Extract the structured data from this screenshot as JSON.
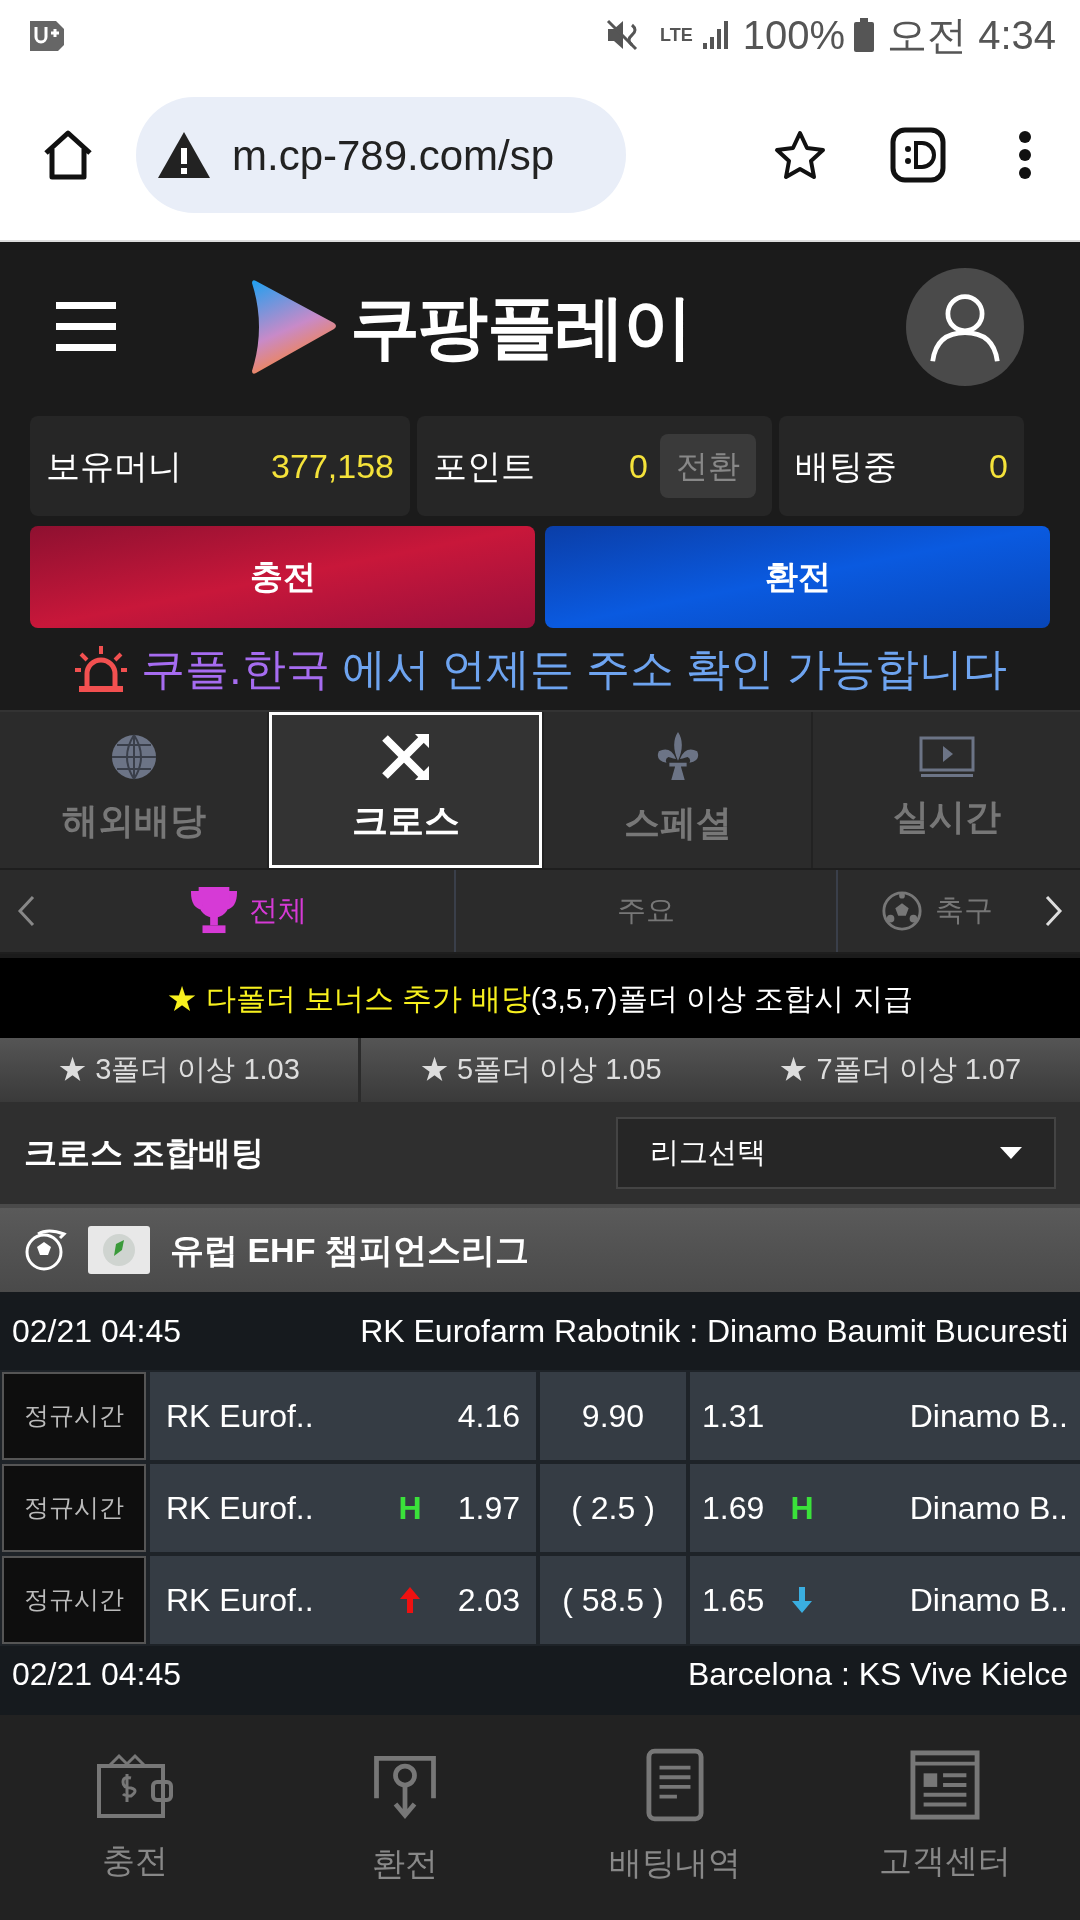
{
  "status_bar": {
    "lte": "LTE",
    "battery": "100%",
    "time": "오전 4:34"
  },
  "browser": {
    "url": "m.cp-789.com/sp"
  },
  "header": {
    "logo_text": "쿠팡플레이"
  },
  "balances": [
    {
      "label": "보유머니",
      "value": "377,158"
    },
    {
      "label": "포인트",
      "value": "0",
      "action": "전환"
    },
    {
      "label": "배팅중",
      "value": "0"
    }
  ],
  "actions": [
    {
      "label": "충전",
      "kind": "deposit"
    },
    {
      "label": "환전",
      "kind": "withdraw"
    }
  ],
  "notice": {
    "link": "쿠플.한국",
    "text": "에서 언제든 주소 확인 가능합니다"
  },
  "tabs": [
    {
      "label": "해외배당",
      "kind": "globe",
      "selected": false
    },
    {
      "label": "크로스",
      "kind": "cross",
      "selected": true
    },
    {
      "label": "스페셜",
      "kind": "fleur",
      "selected": false
    },
    {
      "label": "실시간",
      "kind": "live",
      "selected": false
    }
  ],
  "categories": [
    {
      "label": "전체",
      "kind": "trophy",
      "selected": true
    },
    {
      "label": "주요",
      "kind": "none",
      "selected": false
    },
    {
      "label": "축구",
      "kind": "ball",
      "selected": false
    }
  ],
  "bonus": {
    "highlight": "★ 다폴더 보너스 추가 배당",
    "text": "(3,5,7)폴더 이상 조합시 지급",
    "tiers": [
      "★ 3폴더 이상 1.03",
      "★ 5폴더 이상 1.05",
      "★ 7폴더 이상 1.07"
    ]
  },
  "section": {
    "title": "크로스 조합배팅",
    "select": "리그선택"
  },
  "league": {
    "name": "유럽 EHF 챔피언스리그"
  },
  "matches": [
    {
      "time": "02/21 04:45",
      "teams": "RK Eurofarm Rabotnik : Dinamo Baumit Bucuresti",
      "rows": [
        {
          "period": "정규시간",
          "home": "RK Eurof..",
          "home_odds": "4.16",
          "middle": "9.90",
          "away_odds": "1.31",
          "away": "Dinamo B.."
        },
        {
          "period": "정규시간",
          "home": "RK Eurof..",
          "home_mark": {
            "kind": "flag",
            "text": "H"
          },
          "home_odds": "1.97",
          "middle": "( 2.5 )",
          "away_odds": "1.69",
          "away_mark": {
            "kind": "flag",
            "text": "H"
          },
          "away": "Dinamo B.."
        },
        {
          "period": "정규시간",
          "home": "RK Eurof..",
          "home_mark": {
            "kind": "up"
          },
          "home_odds": "2.03",
          "middle": "( 58.5 )",
          "away_odds": "1.65",
          "away_mark": {
            "kind": "down"
          },
          "away": "Dinamo B.."
        }
      ]
    },
    {
      "time": "02/21 04:45",
      "teams": "Barcelona : KS Vive Kielce"
    }
  ],
  "bottom_nav": [
    {
      "label": "충전",
      "kind": "wallet"
    },
    {
      "label": "환전",
      "kind": "withdraw"
    },
    {
      "label": "배팅내역",
      "kind": "document"
    },
    {
      "label": "고객센터",
      "kind": "news"
    }
  ]
}
